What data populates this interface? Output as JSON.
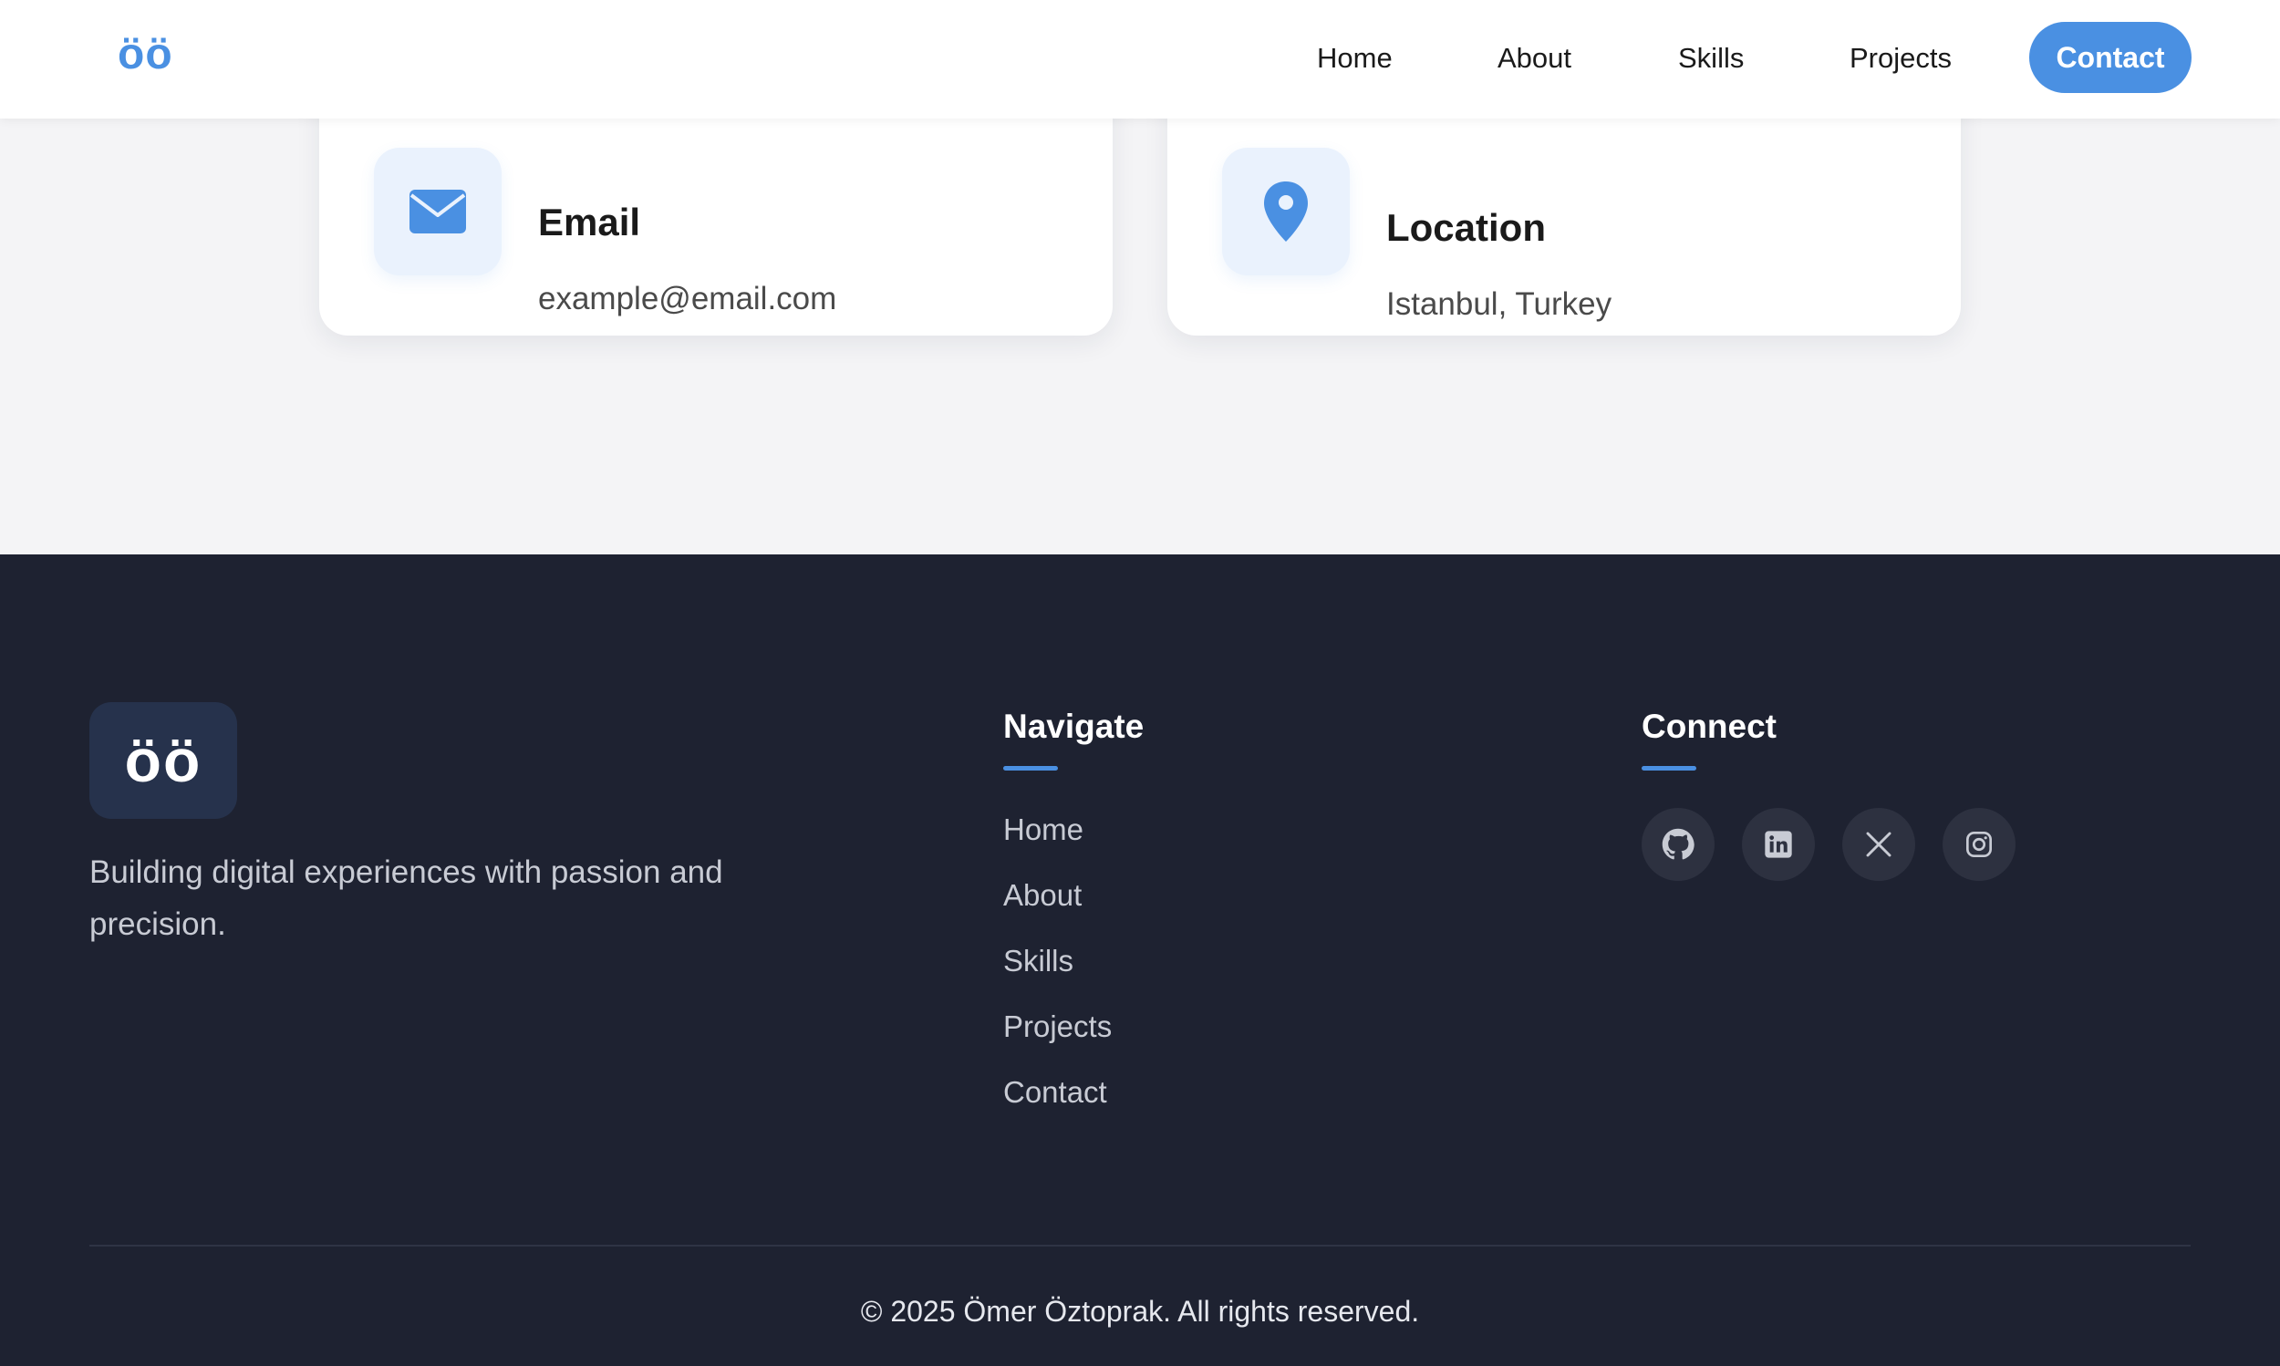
{
  "header": {
    "logo": "öö",
    "nav": [
      "Home",
      "About",
      "Skills",
      "Projects"
    ],
    "contact_label": "Contact"
  },
  "cards": {
    "email": {
      "title": "Email",
      "value": "example@email.com",
      "icon": "envelope-icon"
    },
    "location": {
      "title": "Location",
      "value": "Istanbul, Turkey",
      "icon": "map-pin-icon"
    }
  },
  "footer": {
    "logo": "öö",
    "tagline": "Building digital experiences with passion and precision.",
    "navigate_heading": "Navigate",
    "links": [
      "Home",
      "About",
      "Skills",
      "Projects",
      "Contact"
    ],
    "connect_heading": "Connect",
    "social_icons": [
      "github-icon",
      "linkedin-icon",
      "x-icon",
      "instagram-icon"
    ],
    "copyright": "© 2025 Ömer Öztoprak. All rights reserved."
  },
  "colors": {
    "accent": "#4a90e2",
    "footer_bg": "#1e2231",
    "page_bg": "#f4f4f6"
  }
}
